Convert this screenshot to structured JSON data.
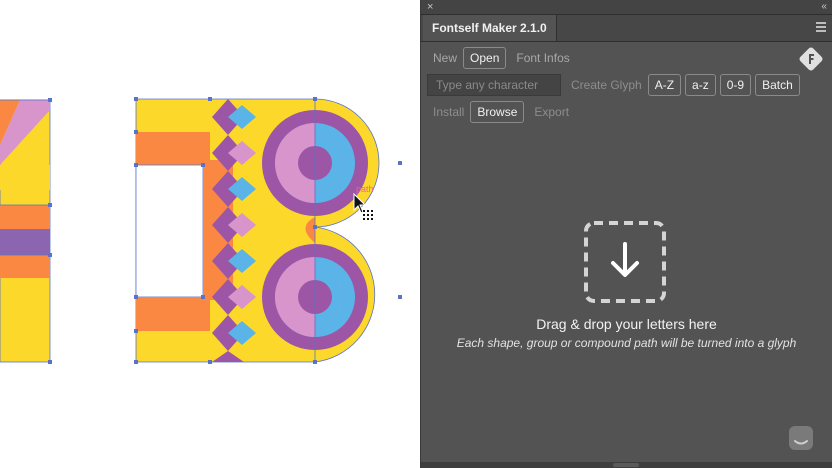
{
  "panel": {
    "title": "Fontself Maker 2.1.0",
    "close_glyph": "×",
    "collapse_glyph": "‹‹",
    "new_label": "New",
    "open_label": "Open",
    "font_infos_label": "Font Infos",
    "char_placeholder": "Type any character",
    "create_glyph_label": "Create Glyph",
    "az_upper_label": "A-Z",
    "az_lower_label": "a-z",
    "digits_label": "0-9",
    "batch_label": "Batch",
    "install_label": "Install",
    "browse_label": "Browse",
    "export_label": "Export",
    "drop_title": "Drag & drop your letters here",
    "drop_subtitle": "Each shape, group or compound path will be turned into a glyph"
  },
  "canvas": {
    "hover_label": "path"
  },
  "icons": {
    "logo": "fontself-logo-icon",
    "drop": "download-arrow-icon",
    "corner": "smile-chat-icon",
    "menu": "hamburger-icon"
  },
  "colors": {
    "panel_bg": "#535353",
    "yellow": "#fcd82a",
    "orange": "#fb8842",
    "purple": "#9c56a5",
    "pink": "#d895cc",
    "blue": "#5bb4e8",
    "selection": "#5a73c8"
  }
}
